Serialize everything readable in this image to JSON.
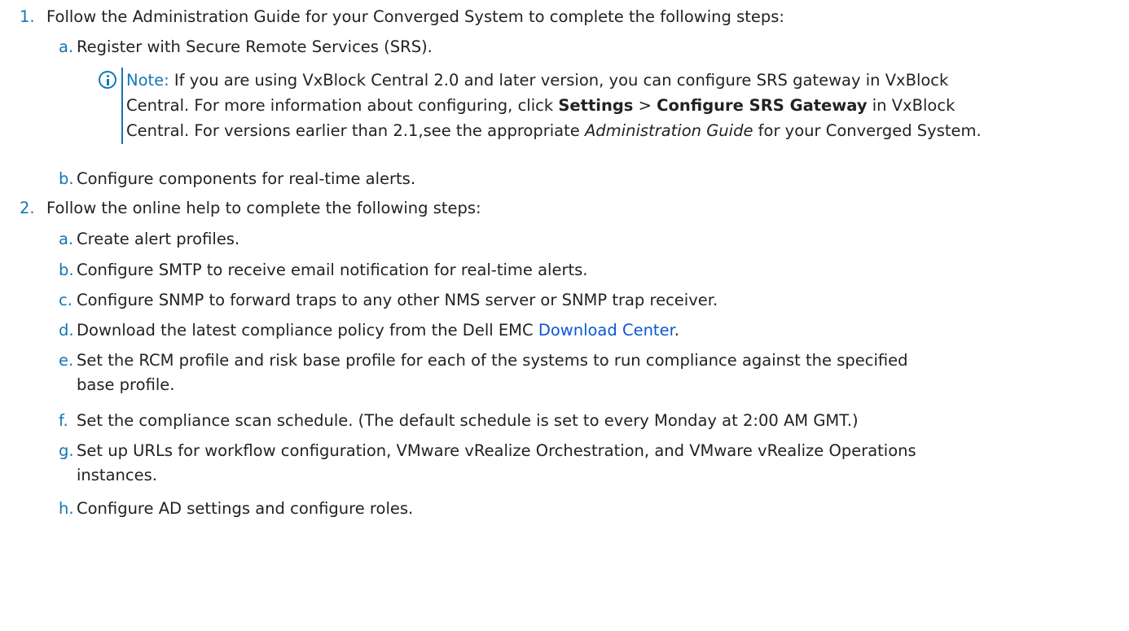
{
  "steps": [
    {
      "marker": "1.",
      "text": "Follow the Administration Guide for your Converged System to complete the following steps:",
      "substeps": [
        {
          "marker": "a.",
          "text": "Register with Secure Remote Services (SRS)."
        },
        {
          "marker": "b.",
          "text": "Configure components for real-time alerts."
        }
      ]
    },
    {
      "marker": "2.",
      "text": "Follow the online help to complete the following steps:",
      "substeps": [
        {
          "marker": "a.",
          "text": "Create alert profiles."
        },
        {
          "marker": "b.",
          "text": "Configure SMTP to receive email notification for real-time alerts."
        },
        {
          "marker": "c.",
          "text": "Configure SNMP to forward traps to any other NMS server or SNMP trap receiver."
        },
        {
          "marker": "d.",
          "text_before": "Download the latest compliance policy from the Dell EMC ",
          "link": "Download Center",
          "text_after": "."
        },
        {
          "marker": "e.",
          "line1": "Set the RCM profile and risk base profile for each of the systems to run compliance against the specified",
          "line2": "base profile."
        },
        {
          "marker": "f.",
          "text": "Set the compliance scan schedule. (The default schedule is set to every Monday at 2:00 AM GMT.)"
        },
        {
          "marker": "g.",
          "line1": "Set up URLs for workflow configuration, VMware vRealize Orchestration, and VMware vRealize Operations",
          "line2": "instances."
        },
        {
          "marker": "h.",
          "text": "Configure AD settings and configure roles."
        }
      ]
    }
  ],
  "note": {
    "label": "Note:",
    "line1": " If you are using VxBlock Central 2.0 and later version, you can configure SRS gateway in VxBlock",
    "line2_a": "Central. For more information about configuring, click ",
    "settings": "Settings",
    "sep": " > ",
    "configure": "Configure SRS Gateway",
    "line2_b": " in VxBlock",
    "line3_a": "Central. For versions earlier than 2.1,see the appropriate ",
    "guide": "Administration Guide",
    "line3_b": " for your Converged System."
  },
  "colors": {
    "accent": "#1277b8",
    "link": "#0a57d6",
    "text": "#222222"
  }
}
